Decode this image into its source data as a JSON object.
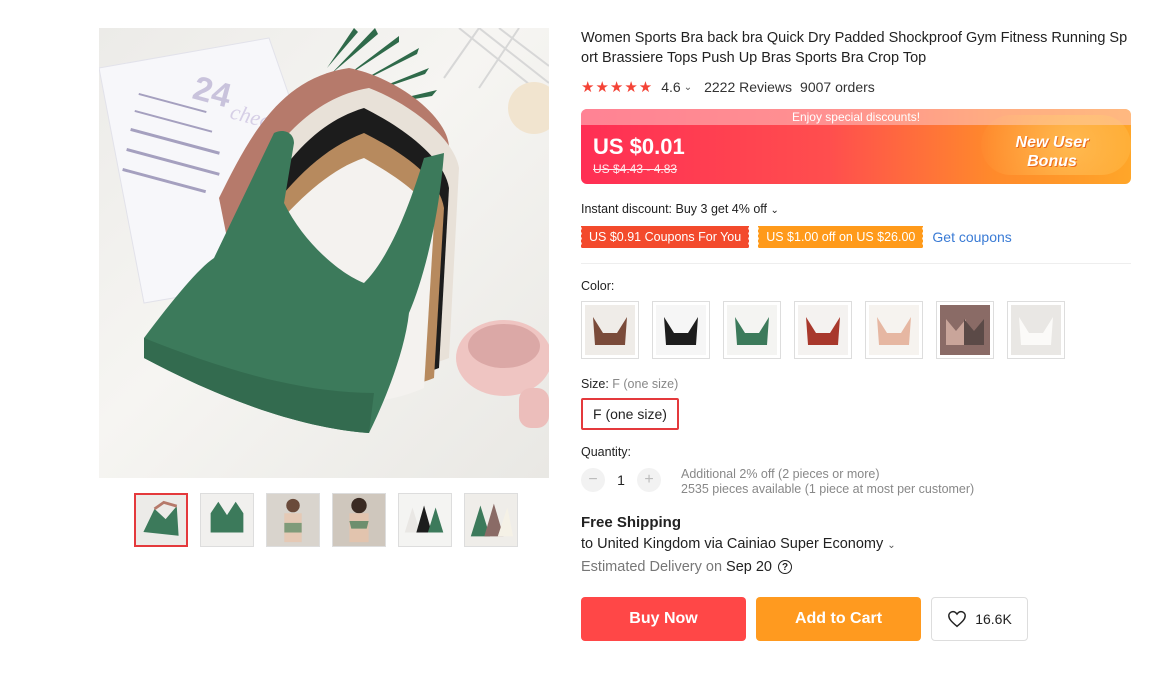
{
  "product": {
    "title": "Women Sports Bra back bra Quick Dry Padded Shockproof Gym Fitness Running Sport Brassiere Tops Push Up Bras Sports Bra Crop Top",
    "rating": "4.6",
    "stars": "★★★★★",
    "rating_value": 4.6,
    "reviews": "2222 Reviews",
    "orders": "9007 orders"
  },
  "price": {
    "banner": "Enjoy special discounts!",
    "current": "US $0.01",
    "original": "US $4.43 - 4.83",
    "bonus_line1": "New User",
    "bonus_line2": "Bonus"
  },
  "discount": {
    "text": "Instant discount: Buy 3 get 4% off"
  },
  "coupons": {
    "items": [
      "US $0.91 Coupons For You",
      "US $1.00 off on US $26.00"
    ],
    "link": "Get coupons"
  },
  "color": {
    "label": "Color:",
    "swatches": [
      {
        "name": "brown",
        "hex": "#7a4b3a"
      },
      {
        "name": "black",
        "hex": "#1d1d1d"
      },
      {
        "name": "green",
        "hex": "#3c7a5b"
      },
      {
        "name": "red",
        "hex": "#a8382c"
      },
      {
        "name": "beige",
        "hex": "#e6b7a2"
      },
      {
        "name": "mixed",
        "hex": "#8a6b66"
      },
      {
        "name": "white",
        "hex": "#f2f0ed"
      }
    ]
  },
  "size": {
    "label": "Size:",
    "selected_hint": "F (one size)",
    "option": "F (one size)"
  },
  "quantity": {
    "label": "Quantity:",
    "value": "1",
    "minus": "−",
    "plus": "+",
    "info_line1": "Additional 2% off (2 pieces or more)",
    "info_line2": "2535 pieces available (1 piece at most per customer)"
  },
  "shipping": {
    "title": "Free Shipping",
    "destination": "to United Kingdom via Cainiao Super Economy",
    "delivery_label": "Estimated Delivery on",
    "delivery_date": "Sep 20",
    "help": "?"
  },
  "actions": {
    "buy": "Buy Now",
    "cart": "Add to Cart",
    "wishlist_count": "16.6K"
  },
  "image_text": {
    "box_number": "24",
    "box_word": "chec"
  },
  "colors": {
    "accent_red": "#ff4747",
    "accent_orange": "#ff9a1f",
    "link_blue": "#3a7bd5"
  }
}
